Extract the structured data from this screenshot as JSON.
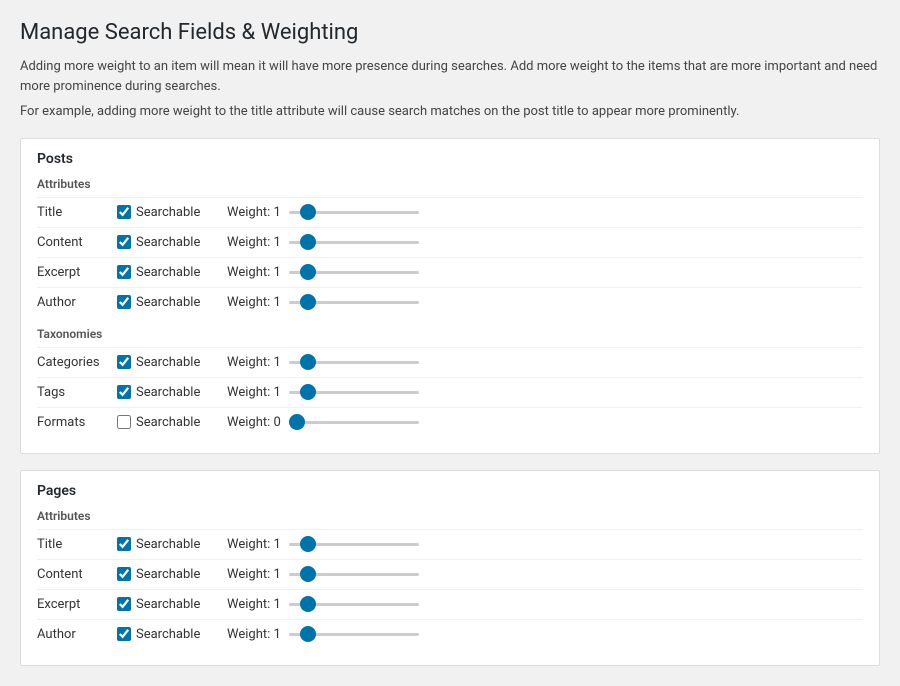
{
  "page": {
    "title": "Manage Search Fields & Weighting",
    "description1": "Adding more weight to an item will mean it will have more presence during searches. Add more weight to the items that are more important and need more prominence during searches.",
    "description2": "For example, adding more weight to the title attribute will cause search matches on the post title to appear more prominently."
  },
  "sections": [
    {
      "id": "posts",
      "title": "Posts",
      "attributes_label": "Attributes",
      "attributes": [
        {
          "name": "Title",
          "searchable": true,
          "weight": 1
        },
        {
          "name": "Content",
          "searchable": true,
          "weight": 1
        },
        {
          "name": "Excerpt",
          "searchable": true,
          "weight": 1
        },
        {
          "name": "Author",
          "searchable": true,
          "weight": 1
        }
      ],
      "taxonomies_label": "Taxonomies",
      "taxonomies": [
        {
          "name": "Categories",
          "searchable": true,
          "weight": 1
        },
        {
          "name": "Tags",
          "searchable": true,
          "weight": 1
        },
        {
          "name": "Formats",
          "searchable": false,
          "weight": 0
        }
      ]
    },
    {
      "id": "pages",
      "title": "Pages",
      "attributes_label": "Attributes",
      "attributes": [
        {
          "name": "Title",
          "searchable": true,
          "weight": 1
        },
        {
          "name": "Content",
          "searchable": true,
          "weight": 1
        },
        {
          "name": "Excerpt",
          "searchable": true,
          "weight": 1
        },
        {
          "name": "Author",
          "searchable": true,
          "weight": 1
        }
      ],
      "taxonomies_label": null,
      "taxonomies": []
    }
  ],
  "labels": {
    "searchable": "Searchable",
    "weight_prefix": "Weight: "
  }
}
